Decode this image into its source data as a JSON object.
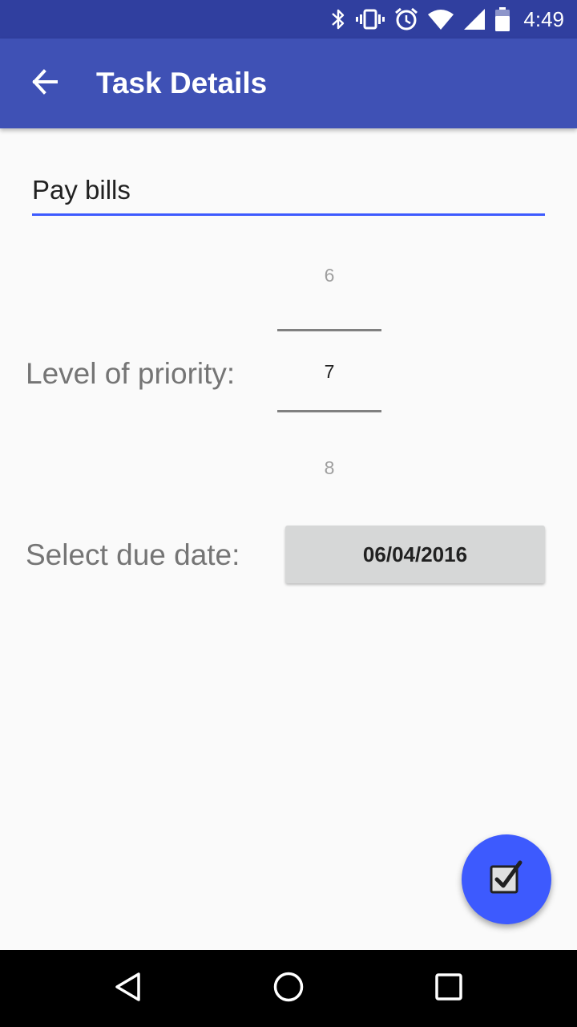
{
  "status_bar": {
    "time": "4:49",
    "icons": [
      "bluetooth-icon",
      "vibrate-icon",
      "alarm-icon",
      "wifi-icon",
      "cell-signal-icon",
      "battery-icon"
    ]
  },
  "app_bar": {
    "title": "Task Details",
    "back_icon": "arrow-back-icon",
    "color": "#3f51b5",
    "status_color": "#303f9f"
  },
  "task": {
    "name": "Pay bills",
    "underline_color": "#3d5afe"
  },
  "priority": {
    "label": "Level of priority:",
    "previous": "6",
    "current": "7",
    "next": "8"
  },
  "due_date": {
    "label": "Select due date:",
    "button_text": "06/04/2016"
  },
  "fab": {
    "icon": "checkbox-checked-icon",
    "color": "#3d5afe"
  },
  "nav_bar": {
    "icons": [
      "nav-back-icon",
      "nav-home-icon",
      "nav-recents-icon"
    ]
  }
}
